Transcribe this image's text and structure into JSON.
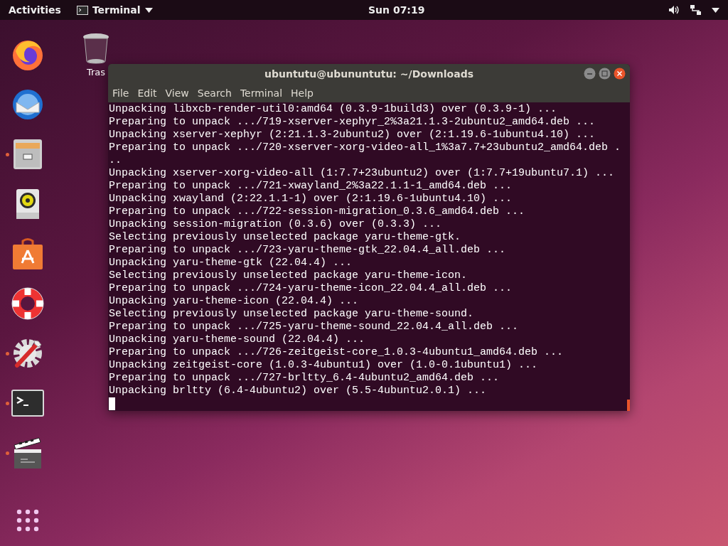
{
  "top_bar": {
    "activities": "Activities",
    "app_menu": "Terminal",
    "clock": "Sun 07:19"
  },
  "dock": [
    {
      "kind": "browser",
      "running": false
    },
    {
      "kind": "mail",
      "running": false
    },
    {
      "kind": "files",
      "running": true
    },
    {
      "kind": "music",
      "running": false
    },
    {
      "kind": "software",
      "running": false
    },
    {
      "kind": "help",
      "running": false
    },
    {
      "kind": "settings",
      "running": true
    },
    {
      "kind": "terminal",
      "running": true
    },
    {
      "kind": "video",
      "running": true
    }
  ],
  "desktop_icons": [
    {
      "label": "Tras"
    }
  ],
  "window": {
    "title": "ubuntutu@ubununtutu: ~/Downloads",
    "menu": [
      "File",
      "Edit",
      "View",
      "Search",
      "Terminal",
      "Help"
    ],
    "lines": [
      "Unpacking libxcb-render-util0:amd64 (0.3.9-1build3) over (0.3.9-1) ...",
      "Preparing to unpack .../719-xserver-xephyr_2%3a21.1.3-2ubuntu2_amd64.deb ...",
      "Unpacking xserver-xephyr (2:21.1.3-2ubuntu2) over (2:1.19.6-1ubuntu4.10) ...",
      "Preparing to unpack .../720-xserver-xorg-video-all_1%3a7.7+23ubuntu2_amd64.deb .",
      "..",
      "Unpacking xserver-xorg-video-all (1:7.7+23ubuntu2) over (1:7.7+19ubuntu7.1) ...",
      "Preparing to unpack .../721-xwayland_2%3a22.1.1-1_amd64.deb ...",
      "Unpacking xwayland (2:22.1.1-1) over (2:1.19.6-1ubuntu4.10) ...",
      "Preparing to unpack .../722-session-migration_0.3.6_amd64.deb ...",
      "Unpacking session-migration (0.3.6) over (0.3.3) ...",
      "Selecting previously unselected package yaru-theme-gtk.",
      "Preparing to unpack .../723-yaru-theme-gtk_22.04.4_all.deb ...",
      "Unpacking yaru-theme-gtk (22.04.4) ...",
      "Selecting previously unselected package yaru-theme-icon.",
      "Preparing to unpack .../724-yaru-theme-icon_22.04.4_all.deb ...",
      "Unpacking yaru-theme-icon (22.04.4) ...",
      "Selecting previously unselected package yaru-theme-sound.",
      "Preparing to unpack .../725-yaru-theme-sound_22.04.4_all.deb ...",
      "Unpacking yaru-theme-sound (22.04.4) ...",
      "Preparing to unpack .../726-zeitgeist-core_1.0.3-4ubuntu1_amd64.deb ...",
      "Unpacking zeitgeist-core (1.0.3-4ubuntu1) over (1.0-0.1ubuntu1) ...",
      "Preparing to unpack .../727-brltty_6.4-4ubuntu2_amd64.deb ...",
      "Unpacking brltty (6.4-4ubuntu2) over (5.5-4ubuntu2.0.1) ..."
    ]
  }
}
